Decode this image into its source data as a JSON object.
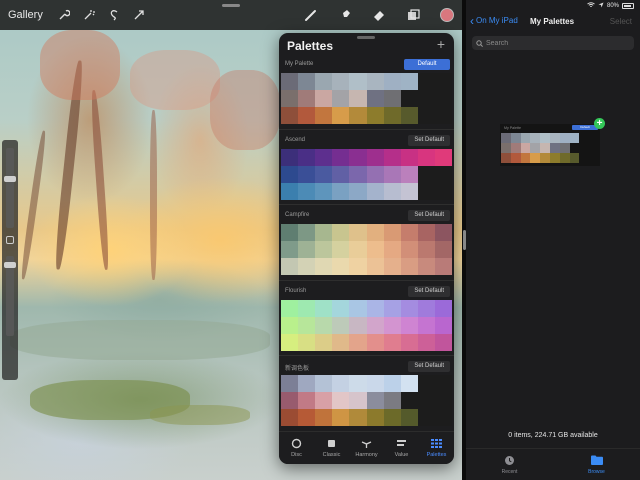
{
  "procreate": {
    "topbar": {
      "gallery_label": "Gallery",
      "left_tools": [
        "wrench-icon",
        "magic-wand-icon",
        "selection-icon",
        "transform-arrow-icon"
      ],
      "right_tools": [
        "brush-icon",
        "smudge-icon",
        "eraser-icon",
        "layers-icon"
      ],
      "current_color": "#d9777e"
    },
    "palettes_panel": {
      "title": "Palettes",
      "add_label": "+",
      "palettes": [
        {
          "name": "My Palette",
          "button": "Default",
          "is_default": true,
          "colors": [
            "#6b6b77",
            "#7d8794",
            "#9aa7b0",
            "#a7b2bb",
            "#b0bfc8",
            "#a9b5c0",
            "#9fb0c3",
            "#9fb3c5",
            "",
            "",
            "#7a6f6c",
            "#a07b79",
            "#caa7a2",
            "#a3a3a7",
            "#c6b6b0",
            "#6f7182",
            "#6f6f73",
            "",
            "",
            "",
            "#8e4f3a",
            "#b2593c",
            "#c2763e",
            "#d79c4a",
            "#b38a3a",
            "#8d7c2c",
            "#6f6a2a",
            "#575a2c",
            "",
            ""
          ]
        },
        {
          "name": "Ascend",
          "button": "Set Default",
          "is_default": false,
          "colors": [
            "#3c2f7a",
            "#4a2f86",
            "#5d2f8e",
            "#752e91",
            "#8a2f91",
            "#9e2f8e",
            "#b52f8a",
            "#c83184",
            "#d8357f",
            "#e03a7a",
            "#2d4a8f",
            "#3a4f97",
            "#4a5aa0",
            "#6160a5",
            "#7b67ac",
            "#9470b2",
            "#a977b7",
            "#bb80bc",
            "",
            "",
            "#3b7fae",
            "#4c8bb6",
            "#5e95bc",
            "#7aa1c2",
            "#8ca8c6",
            "#a4b3cc",
            "#b7bdd0",
            "#c4c3d3",
            "",
            ""
          ]
        },
        {
          "name": "Campfire",
          "button": "Set Default",
          "is_default": false,
          "colors": [
            "#5f7e71",
            "#7d9885",
            "#a7b78f",
            "#c8c58f",
            "#dfc18b",
            "#e2b07f",
            "#d99a74",
            "#c57d6c",
            "#a86462",
            "#8c5560",
            "#7f9b8a",
            "#9eb295",
            "#bcc69c",
            "#d5d19f",
            "#e9cd99",
            "#edbd8d",
            "#e5a983",
            "#d28f78",
            "#bb796f",
            "#a36766",
            "#c3c7b2",
            "#d3d2b5",
            "#e0d8b3",
            "#ead9ad",
            "#efd2a2",
            "#ecc296",
            "#e5b08c",
            "#d99d83",
            "#c88a7d",
            "#b97b78"
          ]
        },
        {
          "name": "Flourish",
          "button": "Set Default",
          "is_default": false,
          "colors": [
            "#9ff09f",
            "#9ee9b0",
            "#9fe1c7",
            "#a4d6dc",
            "#a9c6e4",
            "#aab5e6",
            "#a6a1e4",
            "#a48ce0",
            "#a07bdc",
            "#9b6ad9",
            "#b9f08c",
            "#b7e69a",
            "#b8d9ab",
            "#bdcab9",
            "#c8b7c3",
            "#d2a5cb",
            "#d394d0",
            "#cf84d2",
            "#c574d1",
            "#b966cf",
            "#d6ee7f",
            "#d8df84",
            "#dccd88",
            "#e0b98a",
            "#e3a48b",
            "#e38f8c",
            "#e07d8f",
            "#d86d93",
            "#cd6098",
            "#c1559c"
          ]
        },
        {
          "name": "新调色板",
          "button": "Set Default",
          "is_default": false,
          "colors": [
            "#7c7f96",
            "#9fa8c0",
            "#b4c2d6",
            "#c4d1e3",
            "#cddbe9",
            "#cad8ea",
            "#bcd1e9",
            "#d3e2f1",
            "",
            "",
            "#985b6e",
            "#c17a86",
            "#d8a0a6",
            "#e2c6c7",
            "#d6c4cb",
            "#8b8d9d",
            "#7b7b82",
            "",
            "",
            "",
            "#9b4c33",
            "#b65a36",
            "#c0733b",
            "#cf9544",
            "#b08a3a",
            "#8c7a2c",
            "#6c6a29",
            "#545a2b",
            "",
            ""
          ]
        }
      ],
      "tabs": [
        {
          "label": "Disc",
          "icon": "disc-icon",
          "active": false
        },
        {
          "label": "Classic",
          "icon": "classic-square-icon",
          "active": false
        },
        {
          "label": "Harmony",
          "icon": "harmony-icon",
          "active": false
        },
        {
          "label": "Value",
          "icon": "value-sliders-icon",
          "active": false
        },
        {
          "label": "Palettes",
          "icon": "palettes-grid-icon",
          "active": true
        }
      ]
    }
  },
  "files": {
    "status": {
      "battery": "80%"
    },
    "nav": {
      "back_label": "On My iPad",
      "title": "My Palettes",
      "select_label": "Select"
    },
    "search": {
      "placeholder": "Search"
    },
    "thumbnail": {
      "name": "My Palette",
      "default_label": "Default"
    },
    "storage_text": "0 items, 224.71 GB available",
    "tabs": [
      {
        "label": "Recent",
        "icon": "clock-icon",
        "active": false
      },
      {
        "label": "Browse",
        "icon": "folder-icon",
        "active": true
      }
    ]
  }
}
